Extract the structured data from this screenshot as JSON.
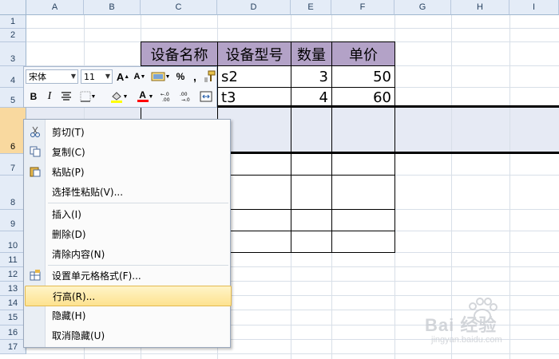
{
  "sheet": {
    "columns": [
      "A",
      "B",
      "C",
      "D",
      "E",
      "F",
      "G",
      "H",
      "I"
    ],
    "rows": [
      "1",
      "2",
      "3",
      "4",
      "5",
      "6",
      "7",
      "8",
      "9",
      "10",
      "11",
      "12",
      "13",
      "14",
      "15",
      "16",
      "17"
    ],
    "header_cells": [
      "设备名称",
      "设备型号",
      "数量",
      "单价"
    ],
    "row4": {
      "model": "s2",
      "qty": "3",
      "price": "50"
    },
    "row5": {
      "model": "t3",
      "qty": "4",
      "price": "60"
    }
  },
  "mini_toolbar": {
    "font_name": "宋体",
    "font_size": "11",
    "bold": "B",
    "italic": "I",
    "percent": "%",
    "comma": ",",
    "font_color_letter": "A",
    "grow_font": "A",
    "shrink_font": "A",
    "font_color": "#ff0000",
    "fill_color": "#ffff00"
  },
  "context_menu": {
    "items": [
      {
        "label": "剪切(T)",
        "icon": "scissors-icon"
      },
      {
        "label": "复制(C)",
        "icon": "copy-icon"
      },
      {
        "label": "粘贴(P)",
        "icon": "paste-icon"
      },
      {
        "label": "选择性粘贴(V)...",
        "icon": ""
      },
      {
        "label": "插入(I)",
        "icon": ""
      },
      {
        "label": "删除(D)",
        "icon": ""
      },
      {
        "label": "清除内容(N)",
        "icon": ""
      },
      {
        "label": "设置单元格格式(F)...",
        "icon": "format-cells-icon"
      },
      {
        "label": "行高(R)...",
        "icon": ""
      },
      {
        "label": "隐藏(H)",
        "icon": ""
      },
      {
        "label": "取消隐藏(U)",
        "icon": ""
      }
    ],
    "highlighted": "行高(R)..."
  },
  "watermark": {
    "text": "Bai 经验",
    "sub": "jingyan.baidu.com"
  },
  "colors": {
    "header_fill": "#b3a2c7",
    "selected_row": "#e6eaf4",
    "menu_highlight": "#fde28f"
  }
}
